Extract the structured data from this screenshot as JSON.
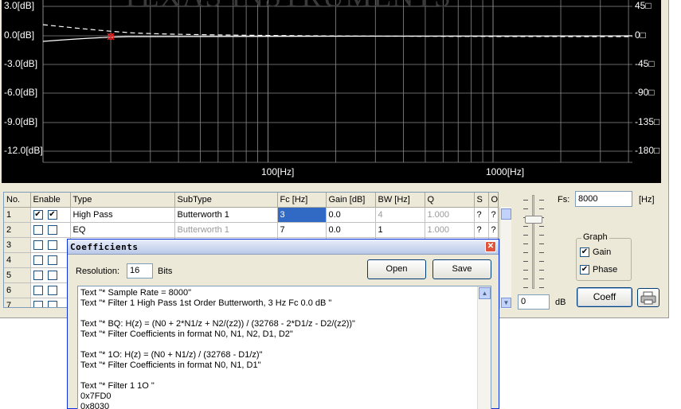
{
  "plot": {
    "watermark": "TEXAS INSTRUMENTS",
    "left_axis_labels": [
      "3.0[dB]",
      "0.0[dB]",
      "-3.0[dB]",
      "-6.0[dB]",
      "-9.0[dB]",
      "-12.0[dB]"
    ],
    "right_axis_labels": [
      "45□",
      "0□",
      "-45□",
      "-90□",
      "-135□",
      "-180□"
    ],
    "x_labels": [
      "100[Hz]",
      "1000[Hz]"
    ],
    "colors": {
      "background": "#000000",
      "grid": "#8a8a8a",
      "gain_curve": "#ffffff",
      "marker": "#ff2020"
    }
  },
  "table": {
    "headers": [
      "No.",
      "Enable",
      "Type",
      "SubType",
      "Fc [Hz]",
      "Gain [dB]",
      "BW [Hz]",
      "Q",
      "S",
      "O"
    ],
    "rows": [
      {
        "no": "1",
        "enable": [
          true,
          true
        ],
        "type": "High Pass",
        "subtype": "Butterworth 1",
        "fc": "3",
        "gain": "0.0",
        "bw": "4",
        "q": "1.000",
        "s": "?",
        "o": "?"
      },
      {
        "no": "2",
        "enable": [
          false,
          false
        ],
        "type": "EQ",
        "subtype": "Butterworth 1",
        "fc": "7",
        "gain": "0.0",
        "bw": "1",
        "q": "1.000",
        "s": "?",
        "o": "?"
      },
      {
        "no": "3",
        "enable": [
          false,
          false
        ],
        "type": "",
        "subtype": "",
        "fc": "",
        "gain": "",
        "bw": "",
        "q": "",
        "s": "",
        "o": ""
      },
      {
        "no": "4",
        "enable": [
          false,
          false
        ],
        "type": "",
        "subtype": "",
        "fc": "",
        "gain": "",
        "bw": "",
        "q": "",
        "s": "",
        "o": ""
      },
      {
        "no": "5",
        "enable": [
          false,
          false
        ],
        "type": "",
        "subtype": "",
        "fc": "",
        "gain": "",
        "bw": "",
        "q": "",
        "s": "",
        "o": ""
      },
      {
        "no": "6",
        "enable": [
          false,
          false
        ],
        "type": "",
        "subtype": "",
        "fc": "",
        "gain": "",
        "bw": "",
        "q": "",
        "s": "",
        "o": ""
      },
      {
        "no": "7",
        "enable": [
          false,
          false
        ],
        "type": "",
        "subtype": "",
        "fc": "",
        "gain": "",
        "bw": "",
        "q": "",
        "s": "",
        "o": ""
      }
    ]
  },
  "controls": {
    "fs_label": "Fs:",
    "fs_value": "8000",
    "fs_unit": "[Hz]",
    "graph_title": "Graph",
    "graph_gain_label": "Gain",
    "graph_gain_checked": true,
    "graph_phase_label": "Phase",
    "graph_phase_checked": true,
    "gain_value": "0",
    "gain_unit": "dB",
    "coeff_button": "Coeff",
    "print_icon": "printer-icon"
  },
  "dialog": {
    "title": "Coefficients",
    "close_glyph": "✕",
    "resolution_label": "Resolution:",
    "resolution_value": "16",
    "bits_label": "Bits",
    "open_button": "Open",
    "save_button": "Save",
    "lines": [
      "Text \"* Sample Rate = 8000\"",
      "Text \"* Filter 1 High Pass 1st Order Butterworth, 3 Hz Fc 0.0 dB \"",
      "",
      "Text \"* BQ: H(z) = (N0 + 2*N1/z + N2/(z2)) / (32768 - 2*D1/z - D2/(z2))\"",
      "Text \"* Filter Coefficients in format N0, N1, N2, D1, D2\"",
      "",
      "Text \"* 1O: H(z) = (N0 + N1/z) / (32768 - D1/z)\"",
      "Text \"* Filter Coefficients in format N0, N1, D1\"",
      "",
      "Text \"* Filter 1 1O \"",
      "0x7FD0",
      "0x8030"
    ]
  }
}
